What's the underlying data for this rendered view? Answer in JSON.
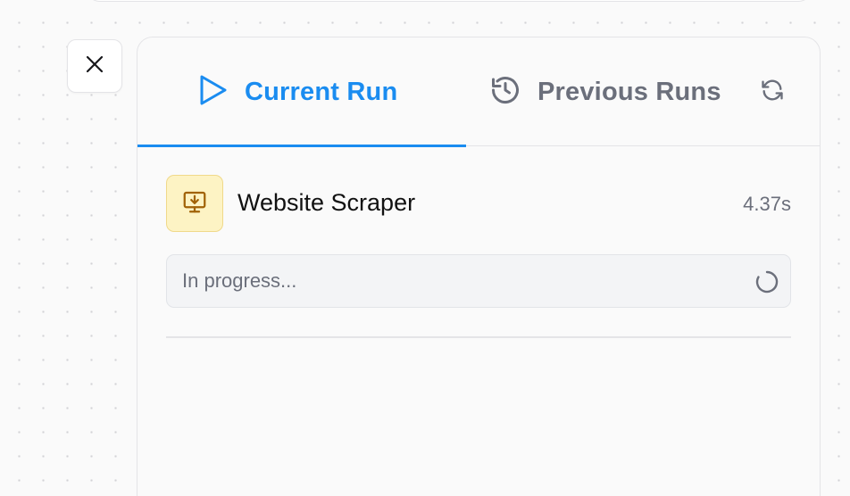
{
  "tabs": {
    "current": {
      "label": "Current Run",
      "icon": "play-icon",
      "active": true
    },
    "previous": {
      "label": "Previous Runs",
      "icon": "history-icon",
      "active": false
    },
    "refresh_icon": "refresh-icon"
  },
  "close_icon": "close-icon",
  "run": {
    "node_icon": "monitor-download-icon",
    "node_name": "Website Scraper",
    "duration": "4.37s",
    "status_text": "In progress...",
    "status_icon": "spinner-icon"
  },
  "colors": {
    "accent": "#1a8cf0",
    "muted_text": "#6b6f7b",
    "node_icon_bg": "#fdf3c4",
    "node_icon_fg": "#a16207"
  }
}
